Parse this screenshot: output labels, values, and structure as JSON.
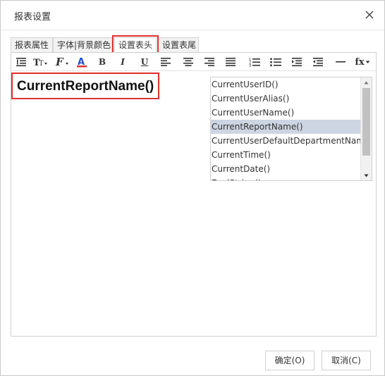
{
  "dialog": {
    "title": "报表设置",
    "close_icon": "close-icon"
  },
  "tabs": [
    {
      "label": "报表属性",
      "active": false
    },
    {
      "label": "字体|背景颜色",
      "active": false
    },
    {
      "label": "设置表头",
      "active": true
    },
    {
      "label": "设置表尾",
      "active": false
    }
  ],
  "toolbar": {
    "icons": [
      "text-indent-icon",
      "font-size-icon",
      "font-family-icon",
      "font-color-icon",
      "bold-icon",
      "italic-icon",
      "underline-icon",
      "align-left-icon",
      "align-center-icon",
      "align-right-icon",
      "align-justify-icon",
      "ordered-list-icon",
      "unordered-list-icon",
      "indent-increase-icon",
      "indent-decrease-icon",
      "horizontal-rule-icon",
      "insert-function-icon"
    ],
    "bold_label": "B",
    "italic_label": "I",
    "underline_label": "U",
    "function_label": "fx"
  },
  "editor": {
    "content": "CurrentReportName()"
  },
  "function_list": {
    "items": [
      "CurrentUserID()",
      "CurrentUserAlias()",
      "CurrentUserName()",
      "CurrentReportName()",
      "CurrentUserDefaultDepartmentName",
      "CurrentTime()",
      "CurrentDate()",
      "EvalString()"
    ],
    "selected_index": 3
  },
  "buttons": {
    "ok": "确定(O)",
    "cancel": "取消(C)"
  },
  "colors": {
    "highlight": "#e0312f",
    "selected_row": "#cdd4e2",
    "font_color_accent": "#1f4fd6"
  }
}
